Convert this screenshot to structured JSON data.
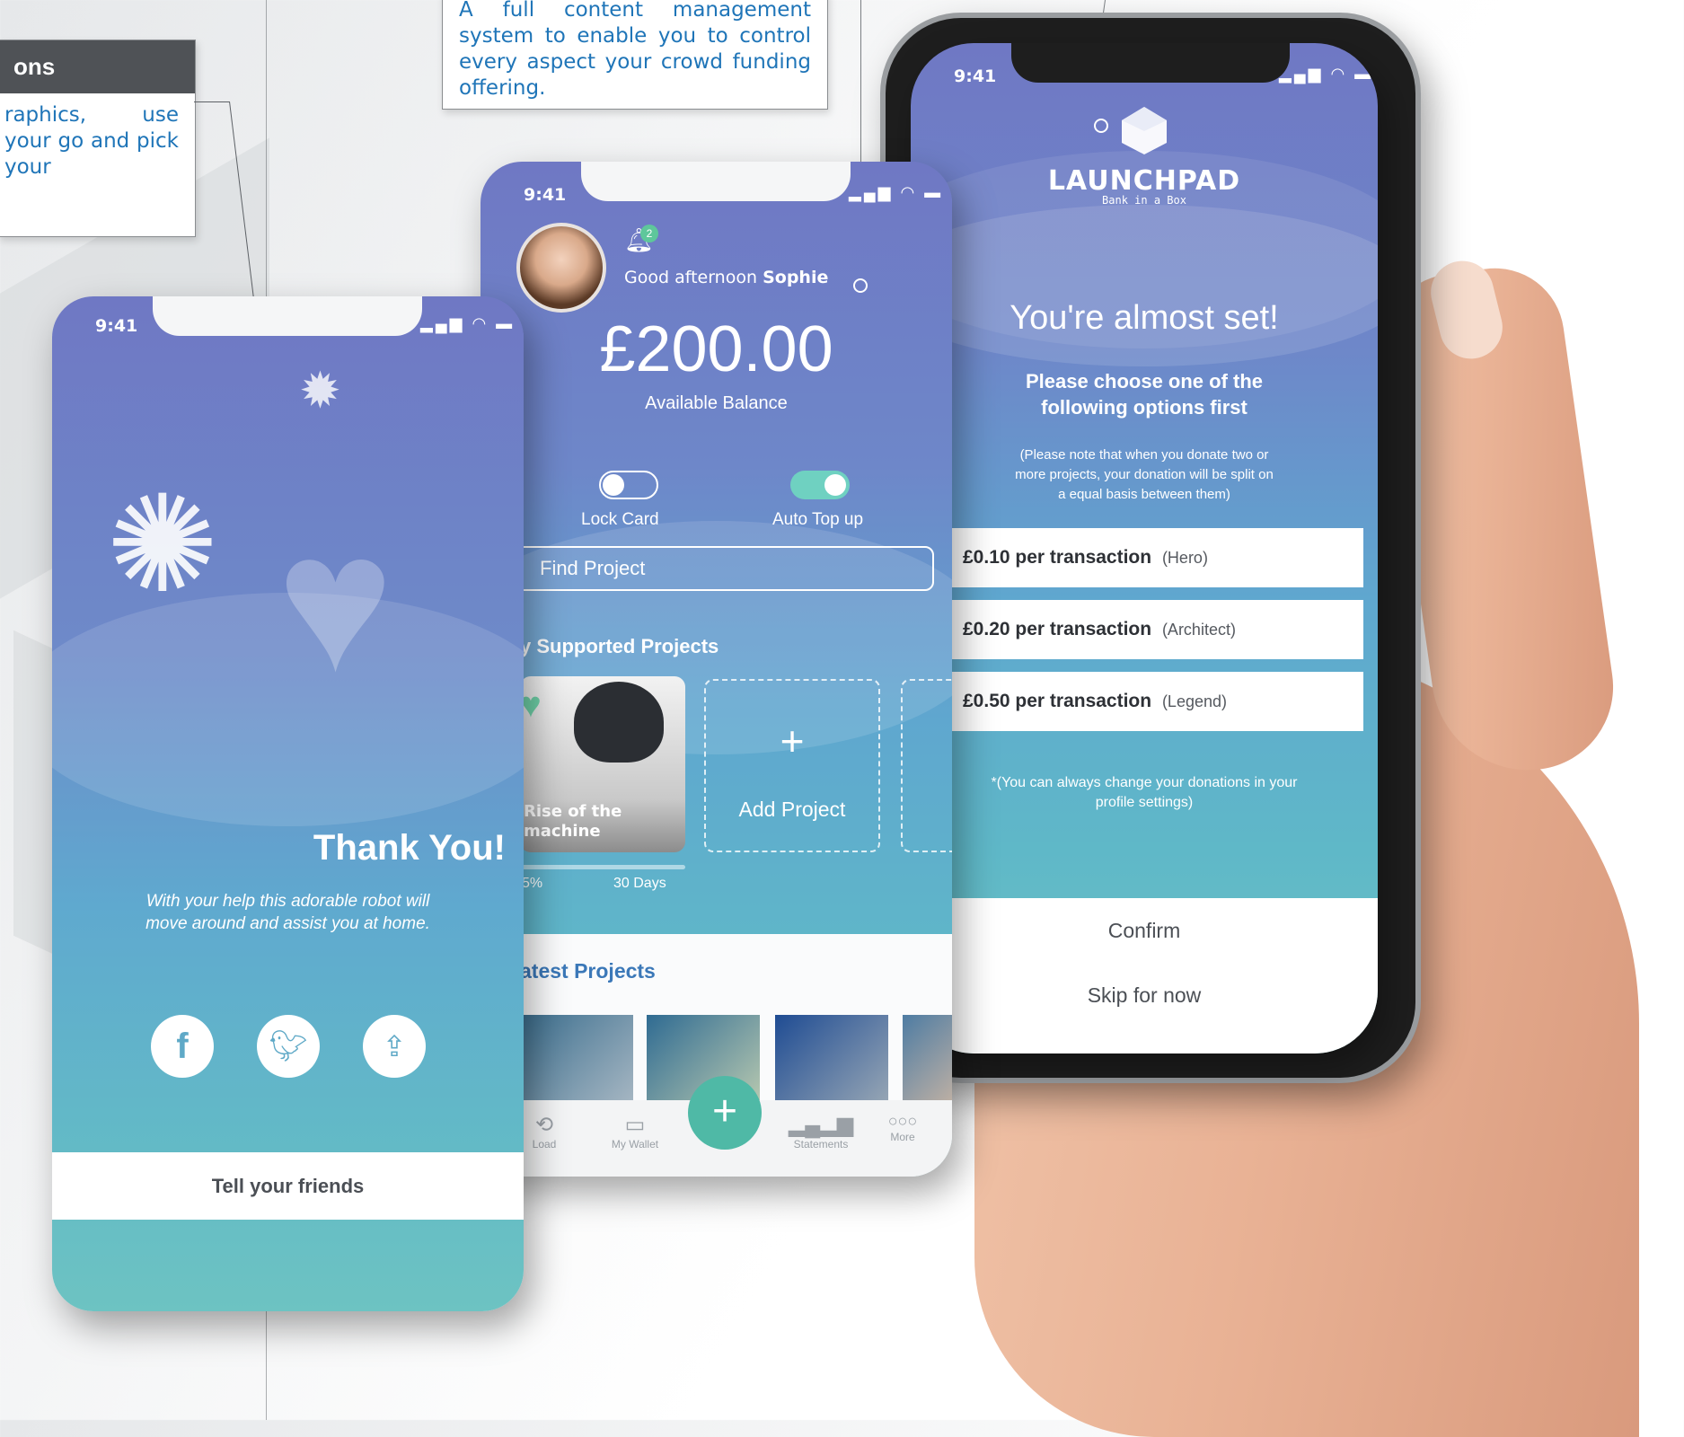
{
  "callout_left": {
    "title": "ons",
    "body": "raphics, use your go and pick your"
  },
  "callout_top": {
    "body": "A full content management system to enable you to control every aspect your crowd funding offering."
  },
  "phone_left": {
    "time": "9:41",
    "heading": "Thank You!",
    "message_line1": "With your help this adorable robot will",
    "message_line2": "move around and assist you at home.",
    "share_button": "Tell your friends",
    "icons": [
      "facebook-icon",
      "twitter-icon",
      "share-icon"
    ]
  },
  "phone_mid": {
    "time": "9:41",
    "notification_count": "2",
    "greeting_prefix": "Good afternoon",
    "greeting_name": "Sophie",
    "balance": "£200.00",
    "balance_label": "Available Balance",
    "toggle_lock_label": "Lock Card",
    "toggle_topup_label": "Auto Top up",
    "lock_card_on": false,
    "auto_top_up_on": true,
    "search_placeholder": "Find Project",
    "supported_heading": "y Supported Projects",
    "project_title_line1": "Rise of the",
    "project_title_line2": "machine",
    "project_percent": "5%",
    "project_days": "30 Days",
    "add_project": "Add Project",
    "latest_heading": "atest Projects",
    "nav": [
      "Load",
      "My Wallet",
      "Statements",
      "More"
    ],
    "fab": "+"
  },
  "phone_right": {
    "time": "9:41",
    "logo_text": "LAUNCHPAD",
    "logo_sub": "Bank in a Box",
    "title": "You're almost set!",
    "subtitle_line1": "Please choose one of the",
    "subtitle_line2": "following options first",
    "note_line1": "(Please note that when you donate two or",
    "note_line2": "more projects, your donation will be split on",
    "note_line3": "a equal basis between them)",
    "options": [
      {
        "amount": "£0.10 per transaction",
        "tier": "(Hero)"
      },
      {
        "amount": "£0.20 per transaction",
        "tier": "(Architect)"
      },
      {
        "amount": "£0.50 per transaction",
        "tier": "(Legend)"
      }
    ],
    "footnote_line1": "*(You can always change your donations in your",
    "footnote_line2": "profile settings)",
    "confirm": "Confirm",
    "skip": "Skip for now"
  }
}
